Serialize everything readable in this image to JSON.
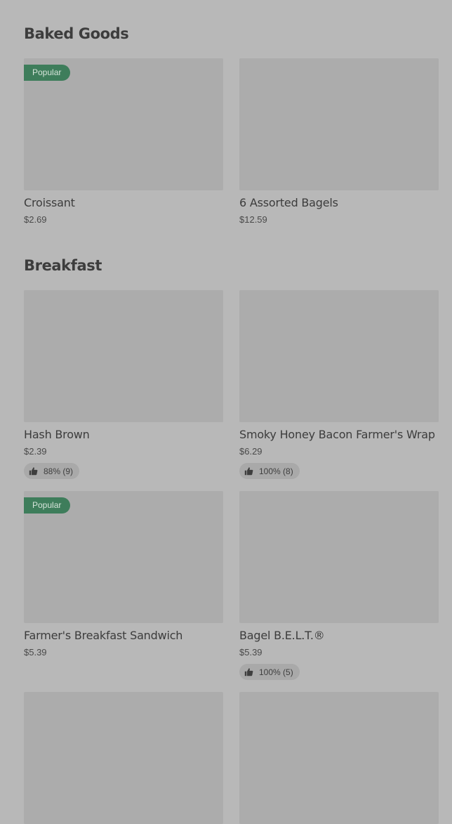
{
  "sections": [
    {
      "title": "Baked Goods",
      "items": [
        {
          "name": "Croissant",
          "price": "$2.69",
          "badge": "Popular"
        },
        {
          "name": "6 Assorted Bagels",
          "price": "$12.59"
        }
      ]
    },
    {
      "title": "Breakfast",
      "items": [
        {
          "name": "Hash Brown",
          "price": "$2.39",
          "rating": "88% (9)"
        },
        {
          "name": "Smoky Honey Bacon Farmer's Wrap",
          "price": "$6.29",
          "rating": "100% (8)"
        },
        {
          "name": "Farmer's Breakfast Sandwich",
          "price": "$5.39",
          "badge": "Popular"
        },
        {
          "name": "Bagel B.E.L.T.®",
          "price": "$5.39",
          "rating": "100% (5)"
        }
      ]
    }
  ],
  "icons": {
    "rating": "thumbs-up-icon"
  },
  "colors": {
    "badge": "#3e7d5b",
    "background": "#b8b8b8",
    "thumbnail": "#acacac"
  }
}
